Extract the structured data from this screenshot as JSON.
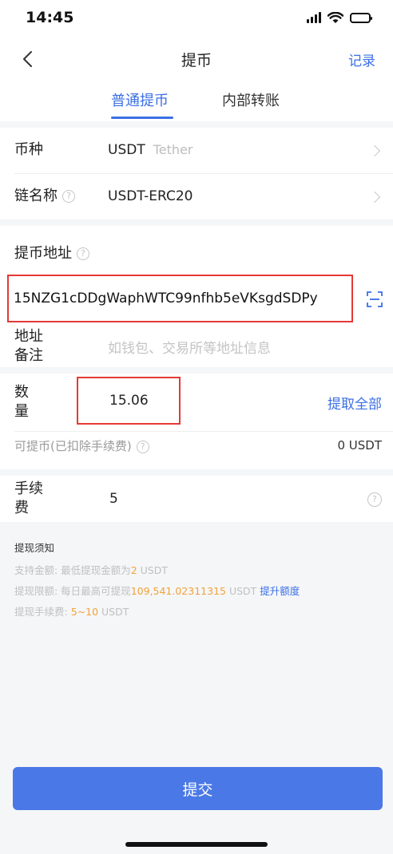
{
  "status": {
    "time": "14:45"
  },
  "nav": {
    "title": "提币",
    "record": "记录"
  },
  "tabs": [
    {
      "label": "普通提币"
    },
    {
      "label": "内部转账"
    }
  ],
  "form": {
    "coin_label": "币种",
    "coin_value": "USDT",
    "coin_sub": "Tether",
    "chain_label": "链名称",
    "chain_value": "USDT-ERC20",
    "address_label": "提币地址",
    "address_value": "15NZG1cDDgWaphWTC99nfhb5eVKsgdSDPy",
    "remark_label_1": "地址",
    "remark_label_2": "备注",
    "remark_placeholder": "如钱包、交易所等地址信息",
    "amount_label_1": "数",
    "amount_label_2": "量",
    "amount_value": "15.06",
    "withdraw_all": "提取全部",
    "available_label": "可提币(已扣除手续费)",
    "available_value": "0 USDT",
    "fee_label_1": "手续",
    "fee_label_2": "费",
    "fee_value": "5"
  },
  "notes": {
    "title": "提现须知",
    "line1_prefix": "支持金额: 最低提现金额为",
    "line1_value": "2",
    "line1_suffix": " USDT",
    "line2_prefix": "提现限额: 每日最高可提现",
    "line2_value": "109,541.02311315",
    "line2_suffix": " USDT ",
    "line2_link": "提升额度",
    "line3_prefix": "提现手续费: ",
    "line3_value": "5~10",
    "line3_suffix": " USDT"
  },
  "submit_label": "提交",
  "colors": {
    "accent": "#3b6fe6",
    "highlight": "#f2a23a",
    "annotation": "#e53935"
  }
}
